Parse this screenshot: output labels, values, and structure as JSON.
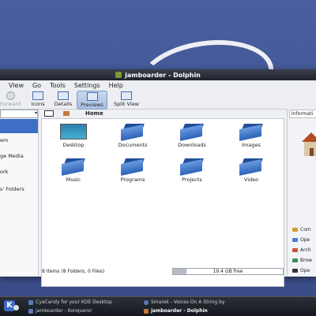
{
  "window": {
    "title": "jamboarder - Dolphin"
  },
  "menu": [
    "View",
    "Go",
    "Tools",
    "Settings",
    "Help"
  ],
  "toolbar": {
    "forward": "Forward",
    "icons": "Icons",
    "details": "Details",
    "previews": "Previews",
    "split_view": "Split View"
  },
  "breadcrumb": {
    "home": "Home"
  },
  "places": [
    "",
    "em",
    "ge Media",
    "ork",
    "s' Folders"
  ],
  "files": [
    {
      "name": "Desktop",
      "icon": "desktop-icon"
    },
    {
      "name": "Documents",
      "icon": "folder-icon"
    },
    {
      "name": "Downloads",
      "icon": "folder-icon"
    },
    {
      "name": "Images",
      "icon": "folder-icon"
    },
    {
      "name": "Music",
      "icon": "folder-icon"
    },
    {
      "name": "Programs",
      "icon": "folder-icon"
    },
    {
      "name": "Projects",
      "icon": "folder-icon"
    },
    {
      "name": "Video",
      "icon": "folder-icon"
    }
  ],
  "status": {
    "text": "8 Items (8 Folders, 0 Files)",
    "free": "19.4 GB free",
    "used_fraction": 0.12
  },
  "info_panel": {
    "title": "Informati",
    "actions": [
      "Com",
      "Ope",
      "Arch",
      "Brow",
      "Ope"
    ]
  },
  "taskbar": {
    "tasks": [
      "CyaCandy for your KDE Desktop",
      "Smarek - Voices On A String by",
      "jamboarder - Konqueror",
      "jamboarder - Dolphin"
    ]
  },
  "colors": {
    "accent": "#3e6fc6",
    "folder": "#2d63b8",
    "titlebar": "#1f232c"
  }
}
